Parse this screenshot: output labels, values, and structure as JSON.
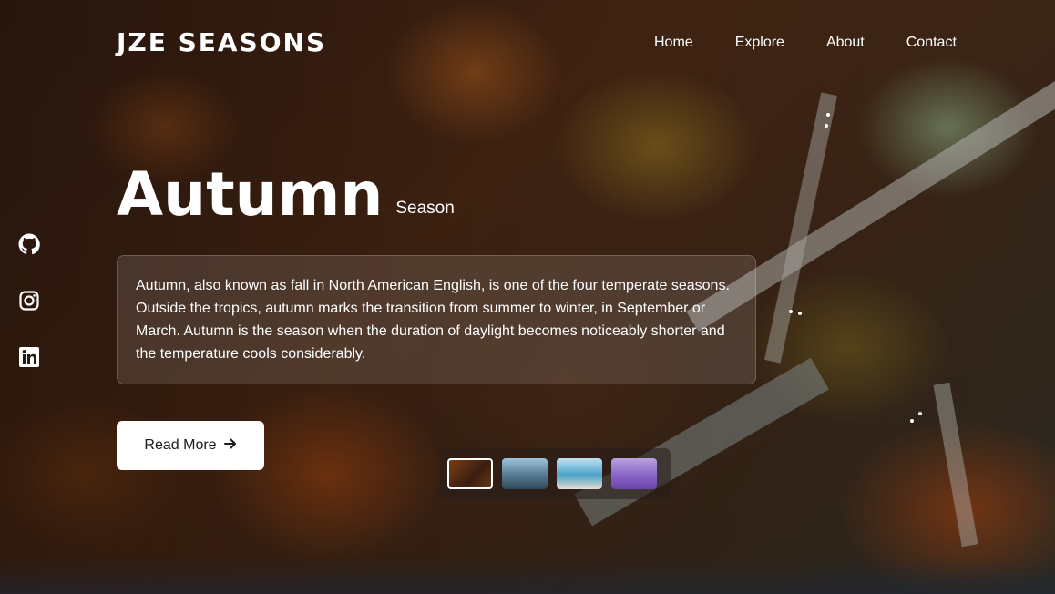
{
  "brand": {
    "name": "JZE SEASONS"
  },
  "nav": {
    "items": [
      "Home",
      "Explore",
      "About",
      "Contact"
    ]
  },
  "hero": {
    "title": "Autumn",
    "subtitle": "Season",
    "description": "Autumn, also known as fall in North American English, is one of the four temperate seasons. Outside the tropics, autumn marks the transition from summer to winter, in September or March. Autumn is the season when the duration of daylight becomes noticeably shorter and the temperature cools considerably.",
    "cta_label": "Read More",
    "cta_icon": "arrow-right-icon"
  },
  "social": {
    "icons": [
      "github-icon",
      "instagram-icon",
      "linkedin-icon"
    ]
  },
  "thumbnails": {
    "items": [
      "autumn",
      "mountain-lake",
      "coast",
      "lavender"
    ],
    "selected_index": 0
  },
  "colors": {
    "text": "#ffffff",
    "button_bg": "#ffffff",
    "button_text": "#1a1a1a"
  }
}
